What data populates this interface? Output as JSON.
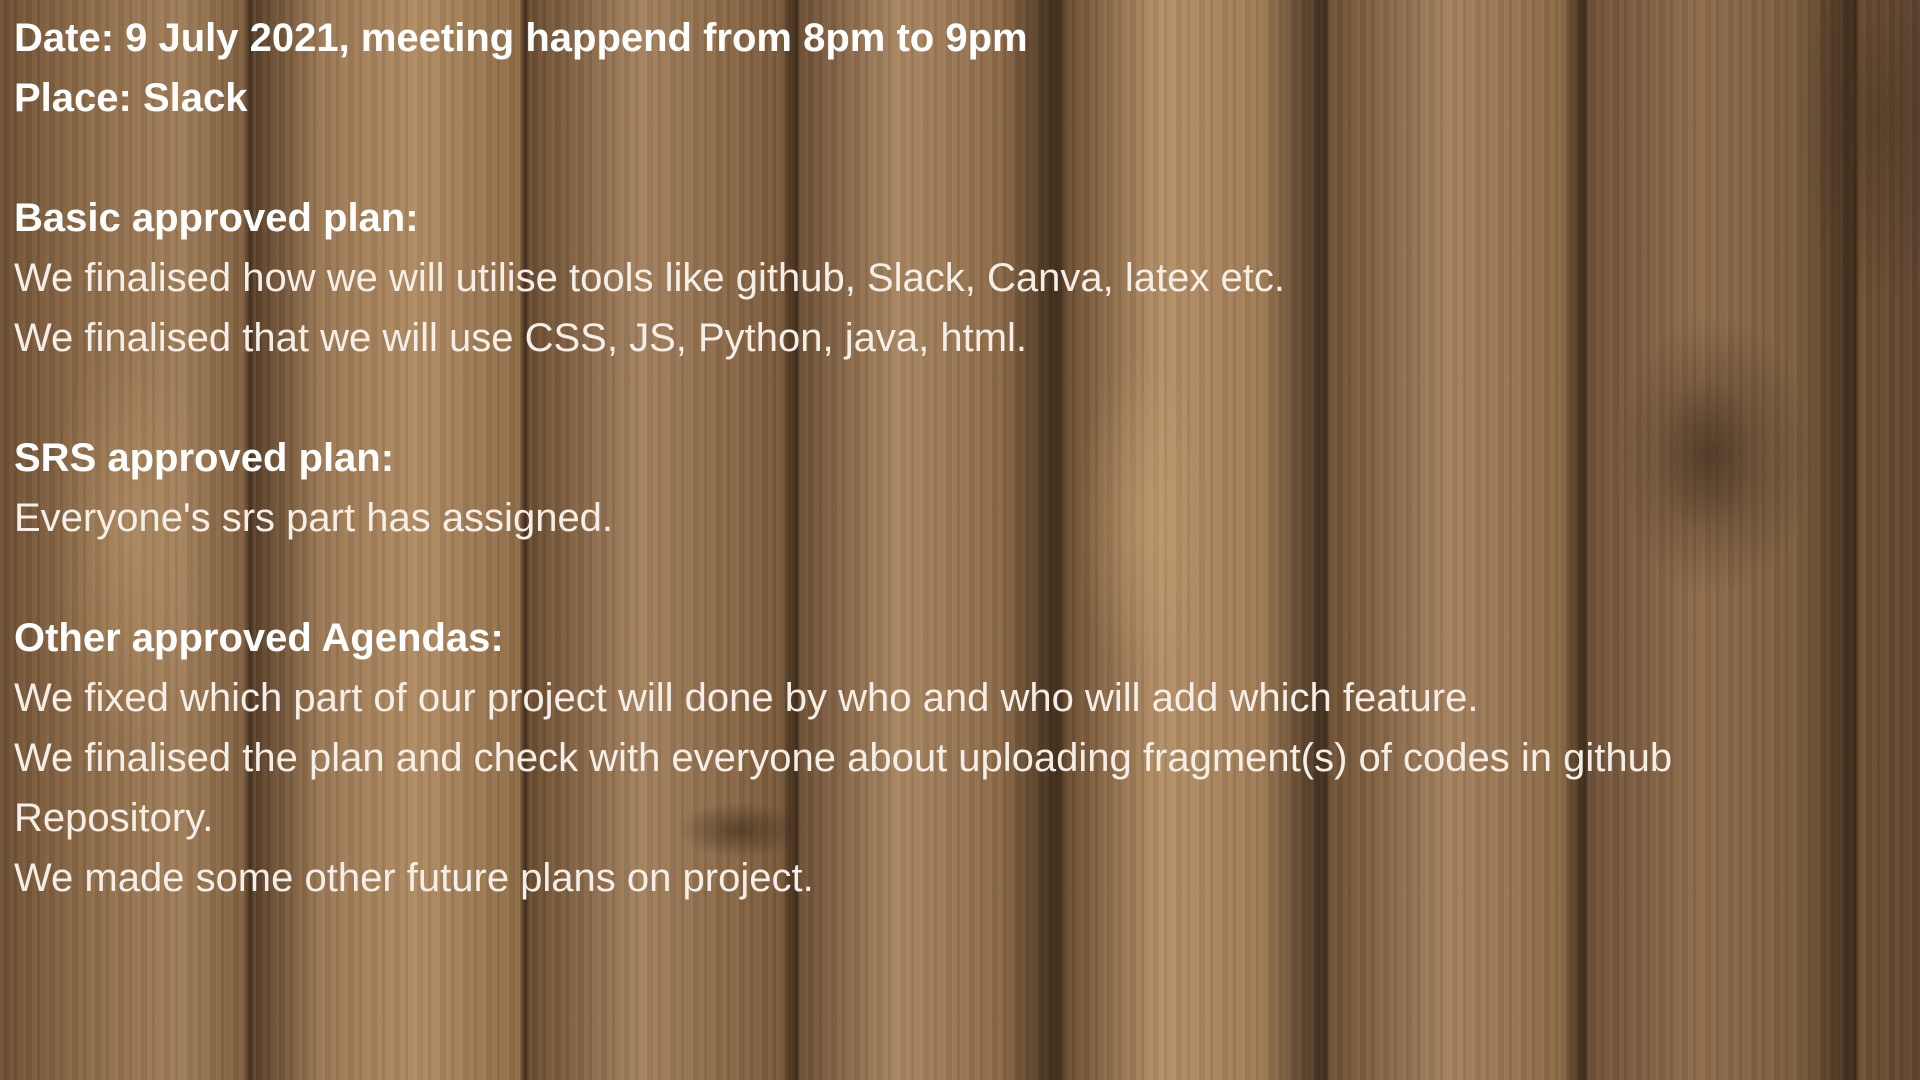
{
  "header": {
    "date_line": "Date: 9 July 2021, meeting happend from 8pm to 9pm",
    "place_line": "Place: Slack"
  },
  "sections": {
    "basic": {
      "heading": "Basic approved plan:",
      "lines": [
        "We finalised how we will utilise tools like github, Slack, Canva, latex etc.",
        "We finalised that we will use CSS, JS, Python, java, html."
      ]
    },
    "srs": {
      "heading": "SRS approved plan:",
      "lines": [
        "Everyone's srs part has assigned."
      ]
    },
    "other": {
      "heading": "Other approved Agendas:",
      "lines": [
        "We fixed which part of our project will done by who and who will add which feature.",
        "We finalised the plan and check with everyone about uploading fragment(s) of codes in github",
        "Repository.",
        "We made some other future plans on project."
      ]
    }
  },
  "colors": {
    "text": "#ffffff",
    "wood_base": "#8a6a4a"
  }
}
